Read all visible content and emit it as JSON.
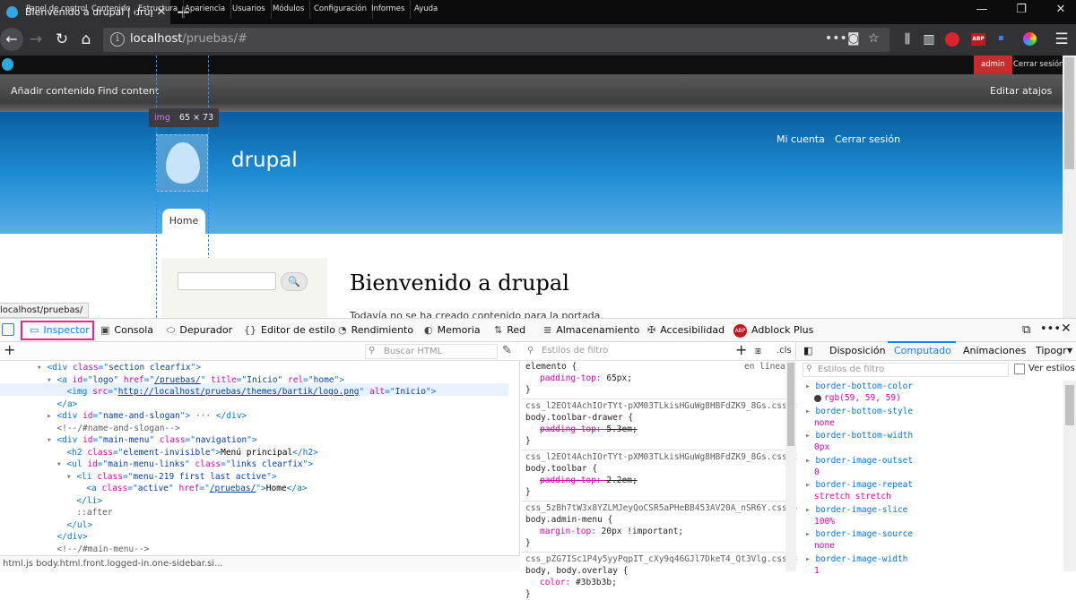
{
  "browser": {
    "tab_title": "Bienvenido a drupal | drupal",
    "url_host": "localhost",
    "url_path": "/pruebas/#"
  },
  "drupal": {
    "toolbar_items": [
      "Panel de control",
      "Contenido",
      "Estructura",
      "Apariencia",
      "Usuarios",
      "Módulos",
      "Configuración",
      "Informes",
      "Ayuda"
    ],
    "admin_label": "admin",
    "logout_label": "Cerrar sesión",
    "shortcuts": [
      "Añadir contenido",
      "Find content"
    ],
    "edit_shortcuts": "Editar atajos",
    "header_links": [
      "Mi cuenta",
      "Cerrar sesión"
    ],
    "site_name": "drupal",
    "menu_home": "Home",
    "page_title": "Bienvenido a drupal",
    "page_text": "Todavía no se ha creado contenido para la portada.",
    "search_button": "🔍",
    "status_url": "localhost/pruebas/",
    "img_tooltip_tag": "img",
    "img_tooltip_size": "65 × 73"
  },
  "devtools": {
    "tabs": [
      "Inspector",
      "Consola",
      "Depurador",
      "Editor de estilo",
      "Rendimiento",
      "Memoria",
      "Red",
      "Almacenamiento",
      "Accesibilidad",
      "Adblock Plus"
    ],
    "html_search_placeholder": "Buscar HTML",
    "html_lines": [
      {
        "indent": 3,
        "arrow": "▾",
        "parts": [
          [
            "tg",
            "<div "
          ],
          [
            "at",
            "class"
          ],
          [
            "tg",
            "=\""
          ],
          [
            "av",
            "section clearfix"
          ],
          [
            "tg",
            "\">"
          ]
        ]
      },
      {
        "indent": 4,
        "arrow": "▾",
        "parts": [
          [
            "tg",
            "<a "
          ],
          [
            "at",
            "id"
          ],
          [
            "tg",
            "=\""
          ],
          [
            "av",
            "logo"
          ],
          [
            "tg",
            "\" "
          ],
          [
            "at",
            "href"
          ],
          [
            "tg",
            "=\""
          ],
          [
            "av",
            "/pruebas/"
          ],
          [
            "tg",
            "\" "
          ],
          [
            "at",
            "title"
          ],
          [
            "tg",
            "=\""
          ],
          [
            "av",
            "Inicio"
          ],
          [
            "tg",
            "\" "
          ],
          [
            "at",
            "rel"
          ],
          [
            "tg",
            "=\""
          ],
          [
            "av",
            "home"
          ],
          [
            "tg",
            "\">"
          ]
        ]
      },
      {
        "indent": 5,
        "arrow": "",
        "parts": [
          [
            "tg",
            "<img "
          ],
          [
            "at",
            "src"
          ],
          [
            "tg",
            "=\""
          ],
          [
            "av",
            "http://localhost/pruebas/themes/bartik/logo.png"
          ],
          [
            "tg",
            "\" "
          ],
          [
            "at",
            "alt"
          ],
          [
            "tg",
            "=\""
          ],
          [
            "av",
            "Inicio"
          ],
          [
            "tg",
            "\">"
          ]
        ]
      },
      {
        "indent": 4,
        "arrow": "",
        "parts": [
          [
            "tg",
            "</a>"
          ]
        ]
      },
      {
        "indent": 4,
        "arrow": "▸",
        "parts": [
          [
            "tg",
            "<div "
          ],
          [
            "at",
            "id"
          ],
          [
            "tg",
            "=\""
          ],
          [
            "av",
            "name-and-slogan"
          ],
          [
            "tg",
            "\">"
          ],
          [
            "cm",
            " ··· "
          ],
          [
            "tg",
            "</div>"
          ]
        ]
      },
      {
        "indent": 4,
        "arrow": "",
        "parts": [
          [
            "cm",
            "<!--/#name-and-slogan-->"
          ]
        ]
      },
      {
        "indent": 4,
        "arrow": "▾",
        "parts": [
          [
            "tg",
            "<div "
          ],
          [
            "at",
            "id"
          ],
          [
            "tg",
            "=\""
          ],
          [
            "av",
            "main-menu"
          ],
          [
            "tg",
            "\" "
          ],
          [
            "at",
            "class"
          ],
          [
            "tg",
            "=\""
          ],
          [
            "av",
            "navigation"
          ],
          [
            "tg",
            "\">"
          ]
        ]
      },
      {
        "indent": 5,
        "arrow": "",
        "parts": [
          [
            "tg",
            "<h2 "
          ],
          [
            "at",
            "class"
          ],
          [
            "tg",
            "=\""
          ],
          [
            "av",
            "element-invisible"
          ],
          [
            "tg",
            "\">"
          ],
          [
            "tx",
            "Menú principal"
          ],
          [
            "tg",
            "</h2>"
          ]
        ]
      },
      {
        "indent": 5,
        "arrow": "▾",
        "parts": [
          [
            "tg",
            "<ul "
          ],
          [
            "at",
            "id"
          ],
          [
            "tg",
            "=\""
          ],
          [
            "av",
            "main-menu-links"
          ],
          [
            "tg",
            "\" "
          ],
          [
            "at",
            "class"
          ],
          [
            "tg",
            "=\""
          ],
          [
            "av",
            "links clearfix"
          ],
          [
            "tg",
            "\">"
          ]
        ]
      },
      {
        "indent": 6,
        "arrow": "▾",
        "parts": [
          [
            "tg",
            "<li "
          ],
          [
            "at",
            "class"
          ],
          [
            "tg",
            "=\""
          ],
          [
            "av",
            "menu-219 first last active"
          ],
          [
            "tg",
            "\">"
          ]
        ]
      },
      {
        "indent": 7,
        "arrow": "",
        "parts": [
          [
            "tg",
            "<a "
          ],
          [
            "at",
            "class"
          ],
          [
            "tg",
            "=\""
          ],
          [
            "av",
            "active"
          ],
          [
            "tg",
            "\" "
          ],
          [
            "at",
            "href"
          ],
          [
            "tg",
            "=\""
          ],
          [
            "av",
            "/pruebas/"
          ],
          [
            "tg",
            "\">"
          ],
          [
            "tx",
            "Home"
          ],
          [
            "tg",
            "</a>"
          ]
        ]
      },
      {
        "indent": 6,
        "arrow": "",
        "parts": [
          [
            "tg",
            "</li>"
          ]
        ]
      },
      {
        "indent": 6,
        "arrow": "",
        "parts": [
          [
            "cm",
            "::after"
          ]
        ]
      },
      {
        "indent": 5,
        "arrow": "",
        "parts": [
          [
            "tg",
            "</ul>"
          ]
        ]
      },
      {
        "indent": 4,
        "arrow": "",
        "parts": [
          [
            "tg",
            "</div>"
          ]
        ]
      },
      {
        "indent": 4,
        "arrow": "",
        "parts": [
          [
            "cm",
            "<!--/#main-menu-->"
          ]
        ]
      }
    ],
    "breadcrumb": "html.js  body.html.front.logged-in.one-sidebar.si...",
    "rules_filter_placeholder": "Estilos de filtro",
    "rules": [
      {
        "selector": "elemento",
        "source": "en línea",
        "props": [
          [
            "padding-top",
            "65px;",
            false
          ]
        ]
      },
      {
        "file": "css_l2EOt4AchIOrTYt-pXM03TLkisHGuWg8HBFdZK9_8Gs.css:2",
        "selector": "body.toolbar-drawer",
        "props": [
          [
            "padding-top",
            "5.3em;",
            true
          ]
        ]
      },
      {
        "file": "css_l2EOt4AchIOrTYt-pXM03TLkisHGuWg8HBFdZK9_8Gs.css:2",
        "selector": "body.toolbar",
        "props": [
          [
            "padding-top",
            "2.2em;",
            true
          ]
        ]
      },
      {
        "file": "css_5zBh7tW3x8YZLMJeyQoCSR5aPHeBB453AV20A_nSR6Y.css:6",
        "selector": "body.admin-menu",
        "props": [
          [
            "margin-top",
            "20px !important;",
            false
          ]
        ]
      },
      {
        "file": "css_pZG7ISc1P4y5yyPqpIT_cXy9q46GJl7DkeT4_Qt3Vlg.css:3",
        "selector": "body, body.overlay",
        "props": [
          [
            "color",
            "#3b3b3b;",
            false
          ]
        ]
      }
    ],
    "computed_tabs": [
      "Disposición",
      "Computado",
      "Animaciones",
      "Tipogr"
    ],
    "computed_filter_placeholder": "Estilos de filtro",
    "browser_styles_label": "Ver estilos",
    "computed": [
      [
        "border-bottom-color",
        "rgb(59, 59, 59)"
      ],
      [
        "border-bottom-style",
        "none"
      ],
      [
        "border-bottom-width",
        "0px"
      ],
      [
        "border-image-outset",
        "0"
      ],
      [
        "border-image-repeat",
        "stretch stretch"
      ],
      [
        "border-image-slice",
        "100%"
      ],
      [
        "border-image-source",
        "none"
      ],
      [
        "border-image-width",
        "1"
      ]
    ]
  },
  "colors": {
    "inspector_highlight": "#e7278b",
    "drupal_blue": "#1d8bd3",
    "admin_red": "#c82c2c"
  }
}
